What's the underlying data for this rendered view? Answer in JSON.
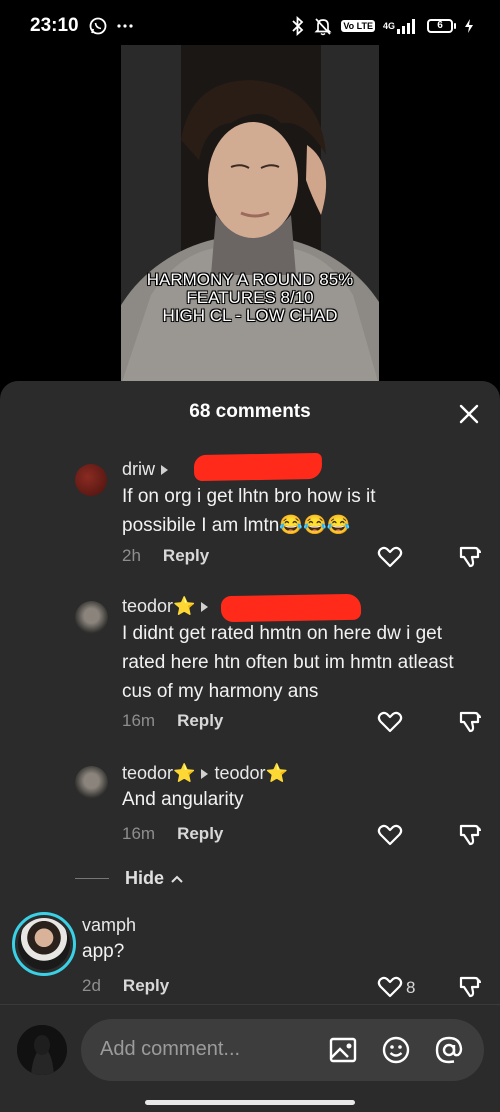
{
  "status_bar": {
    "time": "23:10",
    "left_icons": [
      "whatsapp-icon",
      "more-dots-icon"
    ],
    "right_icons": [
      "bluetooth-icon",
      "silent-bell-icon",
      "volte-icon",
      "signal-icon",
      "charging-icon"
    ],
    "volte_label": "Vo LTE",
    "network_label": "4G",
    "battery_level": "6"
  },
  "video": {
    "overlay_lines": [
      "HARMONY A ROUND 85%",
      "FEATURES 8/10",
      "HIGH CL - LOW CHAD"
    ]
  },
  "comments_sheet": {
    "title": "68 comments",
    "close_icon": "close-icon",
    "hide_label": "Hide",
    "comments": [
      {
        "username": "driw",
        "reply_to": "",
        "text": "If on org i get lhtn bro how is it possibile I am lmtn😂😂😂",
        "age": "2h",
        "reply_label": "Reply",
        "like_count": ""
      },
      {
        "username": "teodor⭐",
        "reply_to": "",
        "text": "I didnt get rated hmtn on here dw i get rated here htn often but im hmtn atleast cus of my harmony ans",
        "age": "16m",
        "reply_label": "Reply",
        "like_count": ""
      },
      {
        "username": "teodor⭐",
        "reply_to": "teodor⭐",
        "text": "And angularity",
        "age": "16m",
        "reply_label": "Reply",
        "like_count": ""
      },
      {
        "username": "vamph",
        "reply_to": "",
        "text": "app?",
        "age": "2d",
        "reply_label": "Reply",
        "like_count": "8"
      }
    ]
  },
  "composer": {
    "placeholder": "Add comment...",
    "icons": [
      "image-icon",
      "emoji-icon",
      "mention-icon"
    ]
  },
  "colors": {
    "sheet_bg": "#2b2b2b",
    "input_bg": "#3d3d3d",
    "redaction": "#ff2a1a",
    "story_ring": "#3ad1e6"
  }
}
